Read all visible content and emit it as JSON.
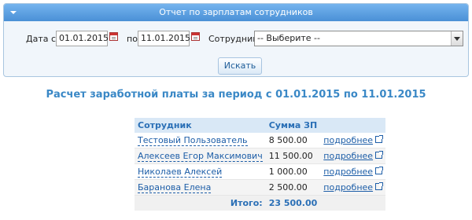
{
  "panel": {
    "title": "Отчет по зарплатам сотрудников",
    "date_from_label": "Дата с:",
    "date_from_value": "01.01.2015",
    "date_to_label": "по",
    "date_to_value": "11.01.2015",
    "employee_label": "Сотрудник:",
    "employee_selected": "-- Выберите --",
    "search_button": "Искать"
  },
  "report": {
    "heading": "Расчет заработной платы за период с 01.01.2015 по 11.01.2015",
    "columns": [
      "Сотрудник",
      "Сумма ЗП"
    ],
    "rows": [
      {
        "name": "Тестовый Пользователь",
        "amount": "8 500.00",
        "link": "подробнее"
      },
      {
        "name": "Алексеев Егор Максимович",
        "amount": "11 500.00",
        "link": "подробнее"
      },
      {
        "name": "Николаев Алексей",
        "amount": "1 000.00",
        "link": "подробнее"
      },
      {
        "name": "Баранова Елена",
        "amount": "2 500.00",
        "link": "подробнее"
      }
    ],
    "total_label": "Итого:",
    "total_value": "23 500.00"
  }
}
